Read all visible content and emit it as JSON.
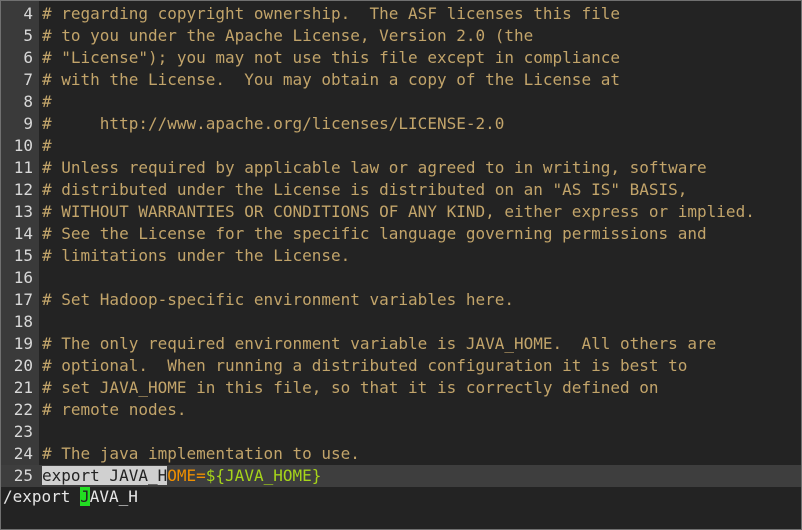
{
  "editor": {
    "lines": [
      {
        "num": "4",
        "text": "# regarding copyright ownership.  The ASF licenses this file"
      },
      {
        "num": "5",
        "text": "# to you under the Apache License, Version 2.0 (the"
      },
      {
        "num": "6",
        "text": "# \"License\"); you may not use this file except in compliance"
      },
      {
        "num": "7",
        "text": "# with the License.  You may obtain a copy of the License at"
      },
      {
        "num": "8",
        "text": "#"
      },
      {
        "num": "9",
        "text": "#     http://www.apache.org/licenses/LICENSE-2.0"
      },
      {
        "num": "10",
        "text": "#"
      },
      {
        "num": "11",
        "text": "# Unless required by applicable law or agreed to in writing, software"
      },
      {
        "num": "12",
        "text": "# distributed under the License is distributed on an \"AS IS\" BASIS,"
      },
      {
        "num": "13",
        "text": "# WITHOUT WARRANTIES OR CONDITIONS OF ANY KIND, either express or implied."
      },
      {
        "num": "14",
        "text": "# See the License for the specific language governing permissions and"
      },
      {
        "num": "15",
        "text": "# limitations under the License."
      },
      {
        "num": "16",
        "text": ""
      },
      {
        "num": "17",
        "text": "# Set Hadoop-specific environment variables here."
      },
      {
        "num": "18",
        "text": ""
      },
      {
        "num": "19",
        "text": "# The only required environment variable is JAVA_HOME.  All others are"
      },
      {
        "num": "20",
        "text": "# optional.  When running a distributed configuration it is best to"
      },
      {
        "num": "21",
        "text": "# set JAVA_HOME in this file, so that it is correctly defined on"
      },
      {
        "num": "22",
        "text": "# remote nodes."
      },
      {
        "num": "23",
        "text": ""
      },
      {
        "num": "24",
        "text": "# The java implementation to use."
      }
    ],
    "current_line": {
      "num": "25",
      "match_text": "export JAVA_H",
      "rest_var": "OME",
      "equals": "=",
      "value": "${JAVA_HOME}"
    }
  },
  "command_line": {
    "before_cursor": "/export ",
    "cursor_char": "J",
    "after_cursor": "AVA_H"
  },
  "colors": {
    "background": "#232323",
    "gutter": "#3a3a3a",
    "comment": "#c2a46a",
    "variable": "#ee8f00",
    "value": "#a6d41a",
    "search_highlight": "#d0d0d0",
    "cursor": "#22dd22"
  }
}
